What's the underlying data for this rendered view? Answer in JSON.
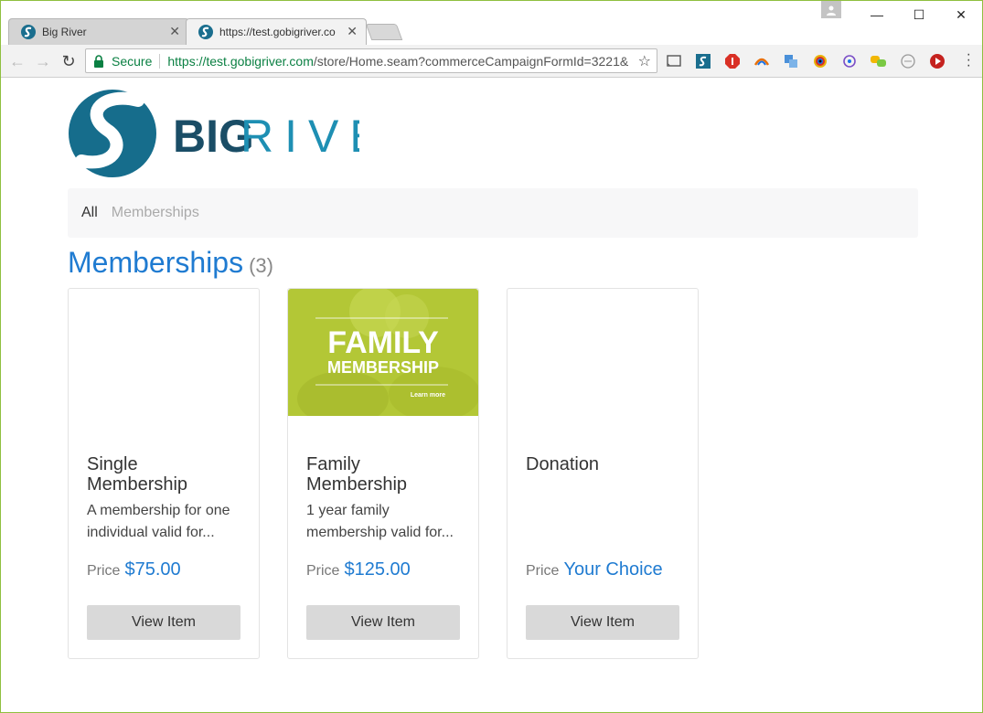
{
  "browser": {
    "tabs": [
      {
        "title": "Big River",
        "active": false
      },
      {
        "title": "https://test.gobigriver.co",
        "active": true
      }
    ],
    "omnibox": {
      "secure_label": "Secure",
      "url_host": "https://test.gobigriver.com",
      "url_path": "/store/Home.seam?commerceCampaignFormId=3221&"
    },
    "extensions": [
      "cast-icon",
      "bigriver-extension-icon",
      "adblock-icon",
      "rainbow-extension-icon",
      "translate-extension-icon",
      "color-picker-extension-icon",
      "target-extension-icon",
      "chat-extension-icon",
      "timer-extension-icon",
      "video-extension-icon"
    ]
  },
  "site": {
    "logo_text_big": "BIG",
    "logo_text_river": "RIVER",
    "brand_color": "#1a6e8e",
    "accent_color": "#1f7bd1"
  },
  "categories": {
    "all_label": "All",
    "memberships_label": "Memberships"
  },
  "section": {
    "title": "Memberships",
    "count": "(3)"
  },
  "items": [
    {
      "title": "Single Membership",
      "description": "A membership for one individual valid for...",
      "price_label": "Price",
      "price_value": "$75.00",
      "button_label": "View Item",
      "has_image": false
    },
    {
      "title": "Family Membership",
      "description": "1 year family membership valid for...",
      "price_label": "Price",
      "price_value": "$125.00",
      "button_label": "View Item",
      "has_image": true,
      "image_heading_1": "FAMILY",
      "image_heading_2": "MEMBERSHIP",
      "image_link": "Learn more"
    },
    {
      "title": "Donation",
      "description": "",
      "price_label": "Price",
      "price_value": "Your Choice",
      "button_label": "View Item",
      "has_image": false
    }
  ]
}
